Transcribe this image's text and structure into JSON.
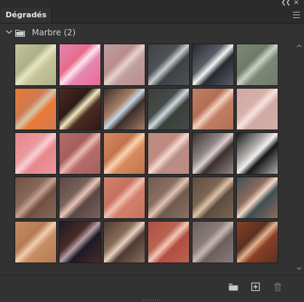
{
  "panel": {
    "tab_label": "Dégradés",
    "group_label": "Marbre (2)",
    "icons": {
      "collapse": "double-chevron-left-icon",
      "close": "close-icon",
      "menu": "hamburger-menu-icon",
      "group_toggle": "chevron-down-icon",
      "folder": "folder-icon",
      "new_group": "new-folder-icon",
      "new_gradient": "add-icon",
      "delete": "trash-icon"
    }
  },
  "swatches": [
    [
      "#c9c49a",
      "#e7e6c4",
      "#aab08a"
    ],
    [
      "#e586b2",
      "#fde2ec",
      "#e66b8d"
    ],
    [
      "#bf9ea0",
      "#e8d2cd",
      "#b98c8c"
    ],
    [
      "#3f4146",
      "#c7cccd",
      "#4d5257"
    ],
    [
      "#272a31",
      "#f4f4f4",
      "#5b5d66"
    ],
    [
      "#7c8775",
      "#cbd1c4",
      "#6f7b69"
    ],
    [
      "#e97936",
      "#d7c3a8",
      "#cf7b50"
    ],
    [
      "#4e2c21",
      "#f2e8bd",
      "#2d1915"
    ],
    [
      "#3a2f2c",
      "#c6d7e3",
      "#a67c63"
    ],
    [
      "#3b3f3b",
      "#cfd9df",
      "#474b49"
    ],
    [
      "#c07e63",
      "#f1d1bf",
      "#b36f55"
    ],
    [
      "#cfa7a4",
      "#f8e2dd",
      "#d6b0a8"
    ],
    [
      "#e8868b",
      "#f9cfd3",
      "#e9989d"
    ],
    [
      "#b66d69",
      "#e9b9b4",
      "#a45e5c"
    ],
    [
      "#d68a5e",
      "#fbd3b0",
      "#c2744e"
    ],
    [
      "#b98d85",
      "#f5d8d0",
      "#bf8a7f"
    ],
    [
      "#3b302d",
      "#dccfd0",
      "#8f8686"
    ],
    [
      "#141718",
      "#f2f0ee",
      "#b1aeac"
    ],
    [
      "#725044",
      "#c7a090",
      "#85695a"
    ],
    [
      "#5b4744",
      "#e9c6b9",
      "#7a625b"
    ],
    [
      "#d47f6b",
      "#f2c1b1",
      "#c4725f"
    ],
    [
      "#6f5a4f",
      "#e3c3b3",
      "#8a7062"
    ],
    [
      "#5d4d3e",
      "#dcc2a6",
      "#7c6654"
    ],
    [
      "#3f4f52",
      "#f0d7c6",
      "#8e6c5f"
    ],
    [
      "#c68c62",
      "#f0ceae",
      "#b57b54"
    ],
    [
      "#1c1a27",
      "#b6a0a6",
      "#4b2a26"
    ],
    [
      "#4e3a31",
      "#e9d1c0",
      "#8a6e5c"
    ],
    [
      "#b34e42",
      "#f3c7b5",
      "#b86351"
    ],
    [
      "#6a5f5e",
      "#c7b7b3",
      "#8a7b78"
    ],
    [
      "#8a3f25",
      "#e3b08c",
      "#5a3123"
    ]
  ]
}
